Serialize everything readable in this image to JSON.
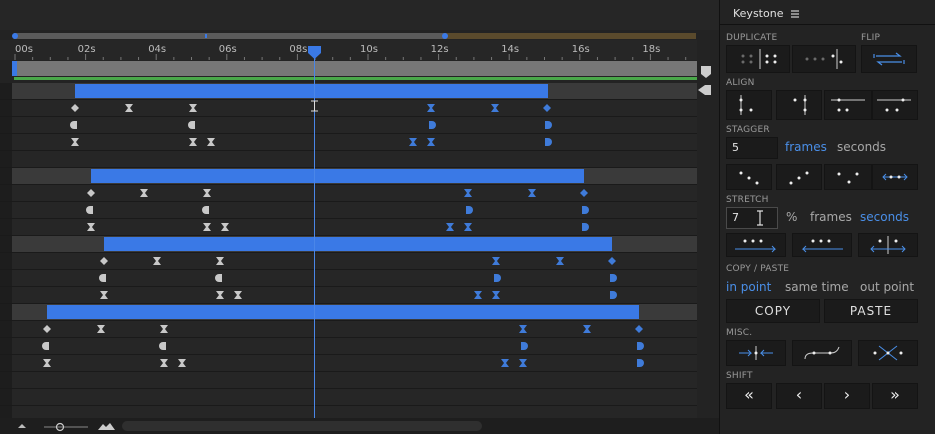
{
  "timeline": {
    "time_labels": [
      "00s",
      "02s",
      "04s",
      "06s",
      "08s",
      "10s",
      "12s",
      "14s",
      "16s",
      "18s"
    ],
    "colors": {
      "accent": "#3a79e6",
      "keyframe_blue": "#3f7bd9",
      "keyframe_gray": "#c8c8c8",
      "green": "#4aa84a"
    }
  },
  "panel": {
    "title": "Keystone",
    "sections": {
      "duplicate": "DUPLICATE",
      "flip": "FLIP",
      "align": "ALIGN",
      "stagger": "STAGGER",
      "stretch": "STRETCH",
      "copy_paste": "COPY / PASTE",
      "misc": "MISC.",
      "shift": "SHIFT"
    },
    "stagger": {
      "value": "5",
      "frames": "frames",
      "seconds": "seconds",
      "active": "frames"
    },
    "stretch": {
      "value": "7",
      "percent": "%",
      "frames": "frames",
      "seconds": "seconds",
      "active": "seconds"
    },
    "copy_paste": {
      "in_point": "in point",
      "same_time": "same time",
      "out_point": "out point",
      "active": "in point",
      "copy": "COPY",
      "paste": "PASTE"
    },
    "shift": {
      "first": "«",
      "prev": "‹",
      "next": "›",
      "last": "»"
    }
  }
}
